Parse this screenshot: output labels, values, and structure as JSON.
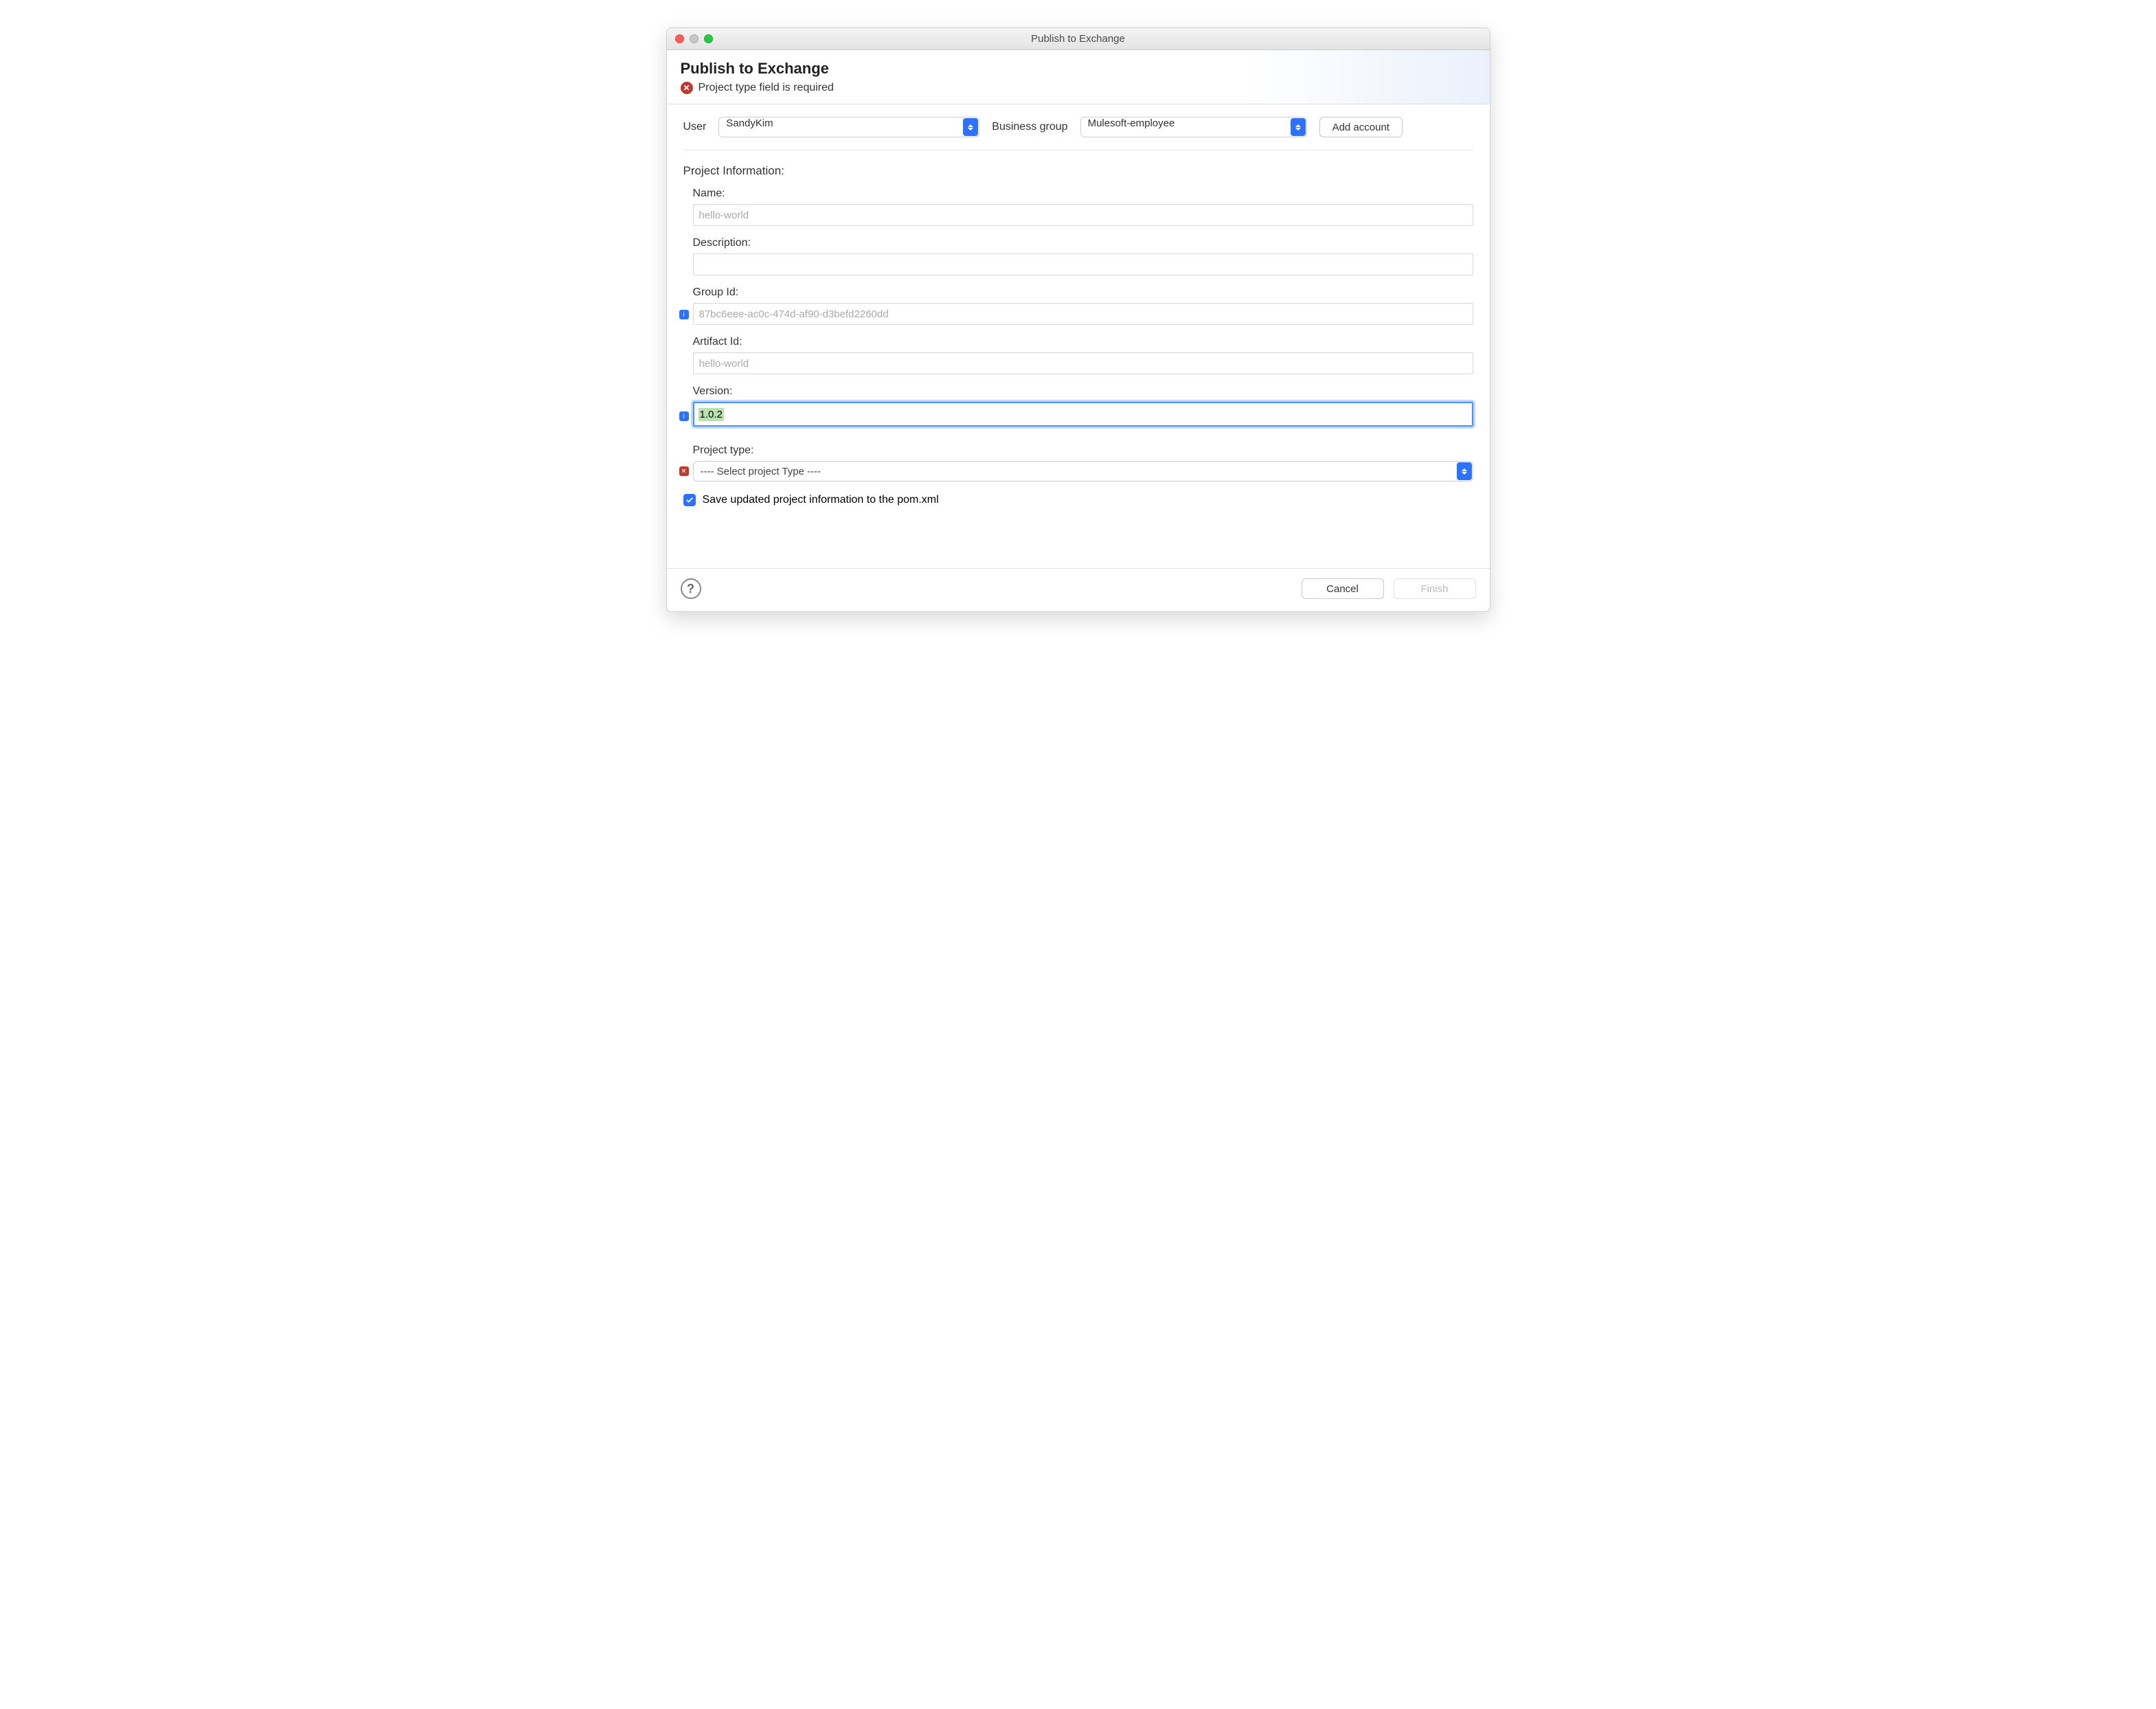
{
  "window": {
    "title": "Publish to Exchange"
  },
  "header": {
    "title": "Publish to Exchange",
    "error_message": "Project type field is required"
  },
  "top": {
    "user_label": "User",
    "user_value": "SandyKim",
    "bg_label": "Business group",
    "bg_value": "Mulesoft-employee",
    "add_account_label": "Add account"
  },
  "section": {
    "title": "Project Information:"
  },
  "fields": {
    "name": {
      "label": "Name:",
      "value": "hello-world"
    },
    "description": {
      "label": "Description:",
      "value": ""
    },
    "group_id": {
      "label": "Group Id:",
      "value": "87bc6eee-ac0c-474d-af90-d3befd2260dd"
    },
    "artifact_id": {
      "label": "Artifact Id:",
      "value": "hello-world"
    },
    "version": {
      "label": "Version:",
      "value": "1.0.2"
    },
    "project_type": {
      "label": "Project type:",
      "value": "---- Select project Type ----"
    }
  },
  "checkbox": {
    "checked": true,
    "label": "Save updated project information to the pom.xml"
  },
  "footer": {
    "cancel": "Cancel",
    "finish": "Finish"
  }
}
